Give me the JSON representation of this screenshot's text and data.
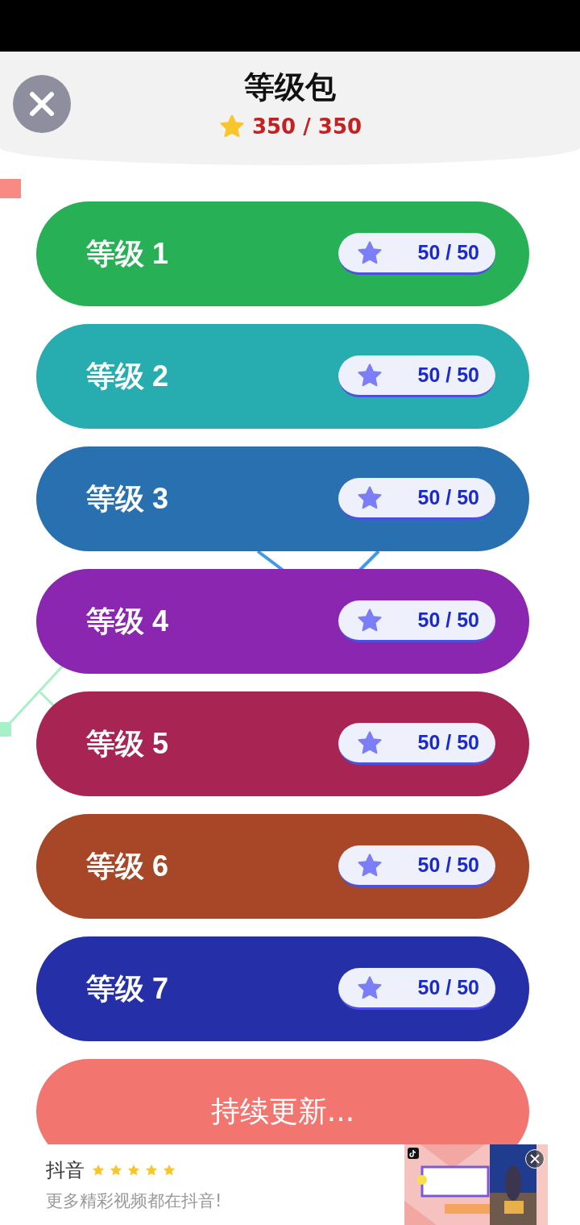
{
  "header": {
    "title": "等级包",
    "score": "350 / 350"
  },
  "levels": [
    {
      "label": "等级 1",
      "progress": "50 / 50",
      "color": "#28b056"
    },
    {
      "label": "等级 2",
      "progress": "50 / 50",
      "color": "#27adb0"
    },
    {
      "label": "等级 3",
      "progress": "50 / 50",
      "color": "#2970b0"
    },
    {
      "label": "等级 4",
      "progress": "50 / 50",
      "color": "#8a26b0"
    },
    {
      "label": "等级 5",
      "progress": "50 / 50",
      "color": "#a82452"
    },
    {
      "label": "等级 6",
      "progress": "50 / 50",
      "color": "#a84727"
    },
    {
      "label": "等级 7",
      "progress": "50 / 50",
      "color": "#2530a8"
    }
  ],
  "more_button": {
    "label": "持续更新..."
  },
  "ad": {
    "title": "抖音",
    "stars": 5,
    "subtitle": "更多精彩视频都在抖音!"
  }
}
